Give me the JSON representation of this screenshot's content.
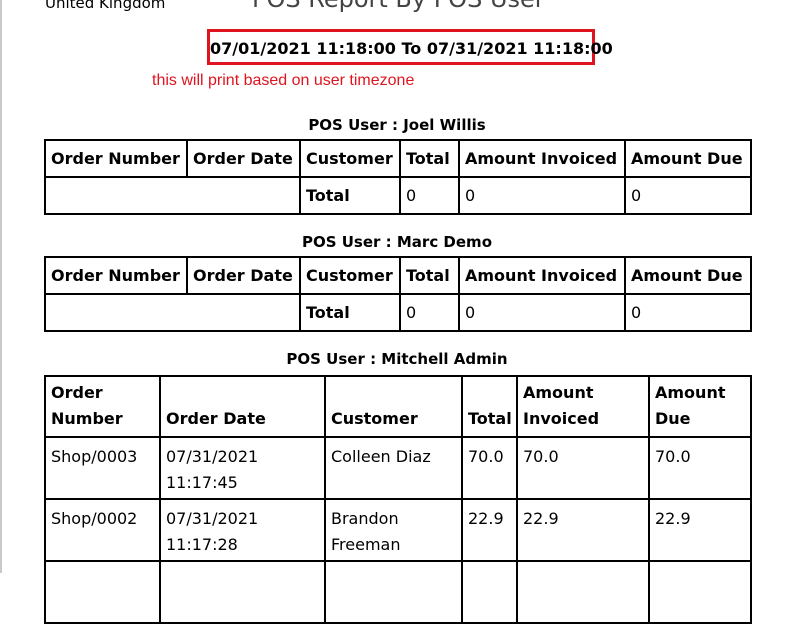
{
  "company": "United Kingdom",
  "report_title": "POS Report By POS User",
  "date_range": "07/01/2021 11:18:00 To 07/31/2021 11:18:00",
  "annotation": "this will print based on user timezone",
  "colors": {
    "annotation_red": "#e0141e",
    "border": "#000000"
  },
  "columns": {
    "order_number": "Order Number",
    "order_date": "Order Date",
    "customer": "Customer",
    "total": "Total",
    "amount_invoiced": "Amount Invoiced",
    "amount_due": "Amount Due"
  },
  "sections": [
    {
      "title": "POS User : Joel Willis",
      "rows": [],
      "summary": {
        "label": "Total",
        "total": "0",
        "amount_invoiced": "0",
        "amount_due": "0"
      }
    },
    {
      "title": "POS User : Marc Demo",
      "rows": [],
      "summary": {
        "label": "Total",
        "total": "0",
        "amount_invoiced": "0",
        "amount_due": "0"
      }
    },
    {
      "title": "POS User : Mitchell Admin",
      "rows": [
        {
          "order_number": "Shop/0003",
          "order_date": "07/31/2021 11:17:45",
          "customer": "Colleen Diaz",
          "total": "70.0",
          "amount_invoiced": "70.0",
          "amount_due": "70.0"
        },
        {
          "order_number": "Shop/0002",
          "order_date": "07/31/2021 11:17:28",
          "customer": "Brandon Freeman",
          "total": "22.9",
          "amount_invoiced": "22.9",
          "amount_due": "22.9"
        }
      ]
    }
  ]
}
